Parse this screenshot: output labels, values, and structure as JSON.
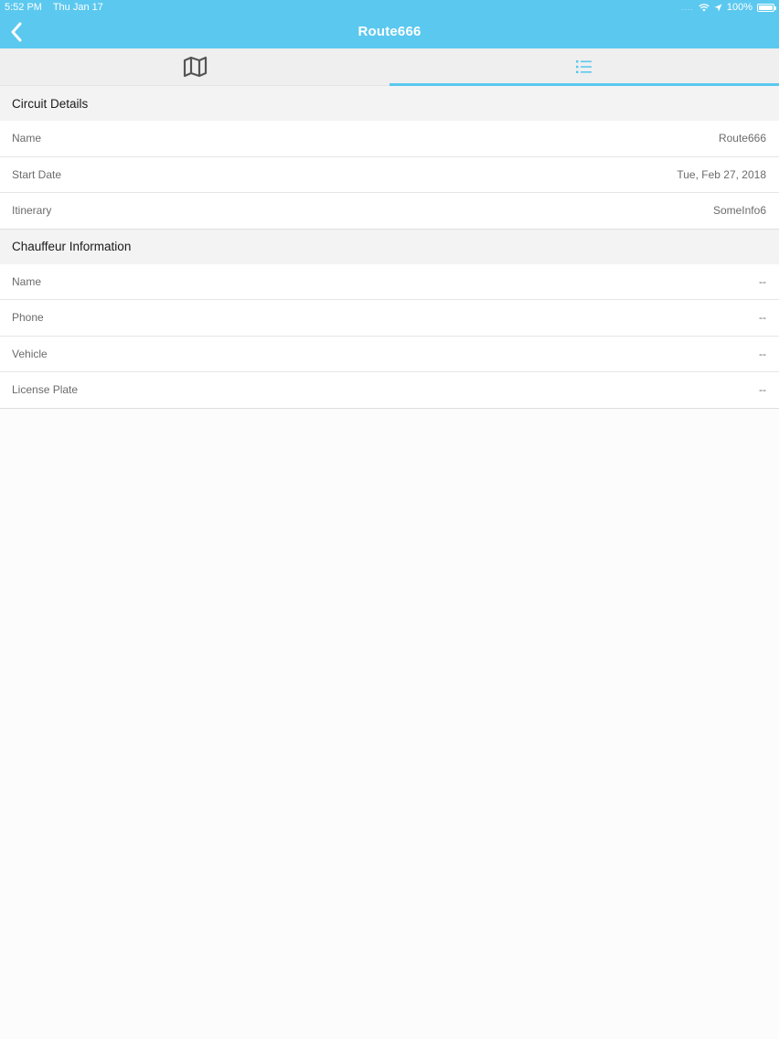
{
  "status_bar": {
    "time": "5:52 PM",
    "date": "Thu Jan 17",
    "signal": "....",
    "battery": "100%",
    "battery_level": 1.0
  },
  "nav": {
    "back_icon": "chevron-left-icon",
    "title": "Route666"
  },
  "tabs": [
    {
      "icon": "map-icon",
      "active": false
    },
    {
      "icon": "list-icon",
      "active": true
    }
  ],
  "sections": {
    "circuit": {
      "header": "Circuit Details",
      "rows": [
        {
          "label": "Name",
          "value": "Route666"
        },
        {
          "label": "Start Date",
          "value": "Tue, Feb 27, 2018"
        },
        {
          "label": "Itinerary",
          "value": "SomeInfo6"
        }
      ]
    },
    "chauffeur": {
      "header": "Chauffeur Information",
      "rows": [
        {
          "label": "Name",
          "value": "--"
        },
        {
          "label": "Phone",
          "value": "--"
        },
        {
          "label": "Vehicle",
          "value": "--"
        },
        {
          "label": "License Plate",
          "value": "--"
        }
      ]
    }
  },
  "colors": {
    "accent": "#5bc8ef",
    "section_bg": "#f3f3f3",
    "tab_bg": "#efefef"
  }
}
